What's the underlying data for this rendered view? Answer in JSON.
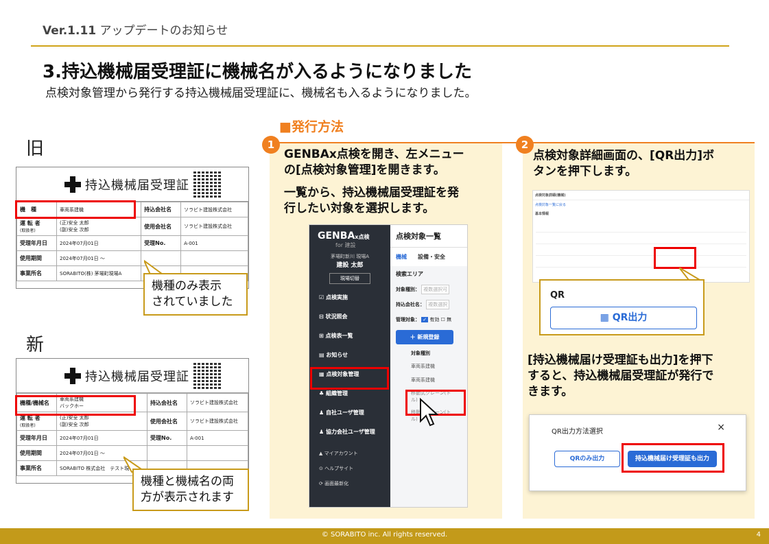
{
  "header": {
    "version": "Ver.1.11",
    "version_sub": " アップデートのお知らせ"
  },
  "title": "3.持込機械届受理証に機械名が入るようになりました",
  "subtitle": "点検対象管理から発行する持込機械届受理証に、機械名も入るようになりました。",
  "old": {
    "label": "旧",
    "cert_title": "持込機械届受理証",
    "rows": [
      [
        "機　種",
        "車両系建機",
        "持込会社名",
        "ソラビト建設株式会社"
      ],
      [
        "運 転 者",
        "(正)安全 太郎\n(副)安全 次郎",
        "使用会社名",
        "ソラビト建設株式会社"
      ],
      [
        "受理年月日",
        "2024年07月01日",
        "受理No.",
        "A-001"
      ],
      [
        "使用期間",
        "2024年07月01日 ～",
        "",
        ""
      ],
      [
        "事業所名",
        "SORABITO(株) 茅場町現場A",
        "",
        ""
      ]
    ],
    "driver_sub": "(取扱者)",
    "callout": "機種のみ表示\nされていました"
  },
  "new": {
    "label": "新",
    "cert_title": "持込機械届受理証",
    "rows": [
      [
        "機種/機械名",
        "車両系建機\nバックホー",
        "持込会社名",
        "ソラビト建設株式会社"
      ],
      [
        "運 転 者",
        "(正)安全 太郎\n(副)安全 次郎",
        "使用会社名",
        "ソラビト建設株式会社"
      ],
      [
        "受理年月日",
        "2024年07月01日",
        "受理No.",
        "A-001"
      ],
      [
        "使用期間",
        "2024年07月01日 ～",
        "",
        ""
      ],
      [
        "事業所名",
        "SORABITO 株式会社　テスト現場",
        "",
        ""
      ]
    ],
    "driver_sub": "(取扱者)",
    "callout": "機種と機械名の両\n方が表示されます"
  },
  "method_heading": "■発行方法",
  "step1": {
    "num": "1",
    "text1": "GENBAx点検を開き、左メニュー\nの[点検対象管理]を開きます。",
    "text2": "一覧から、持込機械届受理証を発\n行したい対象を選択します。"
  },
  "app": {
    "logo": "GENBA",
    "logo_x": "x点検",
    "logo_sub": "for 建設",
    "site": "茅場町新川 現場A",
    "user": "建設 太郎",
    "switch": "現場切替",
    "menu": [
      "点検実施",
      "状況照会",
      "点検表一覧",
      "お知らせ",
      "点検対象管理",
      "組織管理",
      "自社ユーザ管理",
      "協力会社ユーザ管理"
    ],
    "menu_small": [
      "マイアカウント",
      "ヘルプサイト",
      "画面最新化"
    ],
    "page_title": "点検対象一覧",
    "tabs": [
      "機械",
      "設備・安全"
    ],
    "search_area": "検索エリア",
    "f1_label": "対象種別：",
    "f1_ph": "複数選択可",
    "f2_label": "持込会社名：",
    "f2_ph": "複数選択",
    "f3_label": "管理対象：",
    "f3_opt1": "有効",
    "f3_opt2": "無",
    "new_btn": "＋ 新規登録",
    "col": "対象種別",
    "r1": "車両系建機",
    "r2": "車両系建機",
    "r3": "移動式クレーン(ト\nル)",
    "r4": "移動式クレーン(ト\nル)"
  },
  "step2": {
    "num": "2",
    "text": "点検対象詳細画面の、[QR出力]ボ\nタンを押下します。",
    "qr_label": "QR",
    "qr_btn": "QR出力",
    "detail_title": "点検対象詳細(機械)",
    "detail_back": "点検対象一覧に戻る",
    "basic": "基本情報",
    "text2": "[持込機械届け受理証も出力]を押下\nすると、持込機械届受理証が発行で\nきます。",
    "dialog_title": "QR出力方法選択",
    "dialog_close": "×",
    "btn_qr_only": "QRのみ出力",
    "btn_cert": "持込機械届け受理証も出力"
  },
  "footer": {
    "copyright": "© SORABITO inc. All rights reserved.",
    "page": "4"
  }
}
